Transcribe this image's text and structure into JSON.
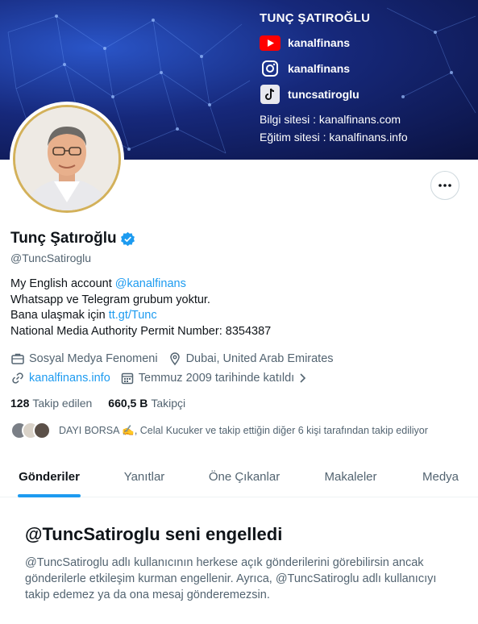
{
  "banner": {
    "name": "TUNÇ ŞATIROĞLU",
    "socials": [
      {
        "icon": "youtube-icon",
        "label": "kanalfinans"
      },
      {
        "icon": "instagram-icon",
        "label": "kanalfinans"
      },
      {
        "icon": "tiktok-icon",
        "label": "tuncsatiroglu"
      }
    ],
    "info_site": "Bilgi sitesi : kanalfinans.com",
    "edu_site": "Eğitim sitesi : kanalfinans.info"
  },
  "profile": {
    "display_name": "Tunç Şatıroğlu",
    "handle": "@TuncSatiroglu",
    "bio": {
      "line1_text": "My English account ",
      "line1_link": "@kanalfinans",
      "line2": "Whatsapp ve Telegram grubum yoktur.",
      "line3_text": "Bana ulaşmak için ",
      "line3_link": "tt.gt/Tunc",
      "line4": "National Media Authority Permit Number: 8354387"
    },
    "category": "Sosyal Medya Fenomeni",
    "location": "Dubai, United Arab Emirates",
    "website": "kanalfinans.info",
    "joined": "Temmuz 2009 tarihinde katıldı",
    "following_count": "128",
    "following_label": "Takip edilen",
    "followers_count": "660,5 B",
    "followers_label": "Takipçi",
    "followed_by": "DAYI BORSA ✍️, Celal Kucuker ve takip ettiğin diğer 6 kişi tarafından takip ediliyor"
  },
  "tabs": [
    {
      "label": "Gönderiler",
      "active": true
    },
    {
      "label": "Yanıtlar",
      "active": false
    },
    {
      "label": "Öne Çıkanlar",
      "active": false
    },
    {
      "label": "Makaleler",
      "active": false
    },
    {
      "label": "Medya",
      "active": false
    }
  ],
  "blocked": {
    "title": "@TuncSatiroglu seni engelledi",
    "text": "@TuncSatiroglu adlı kullanıcının herkese açık gönderilerini görebilirsin ancak gönderilerle etkileşim kurman engellenir. Ayrıca, @TuncSatiroglu adlı kullanıcıyı takip edemez ya da ona mesaj gönderemezsin."
  },
  "colors": {
    "accent": "#1d9bf0",
    "text_primary": "#0f1419",
    "text_secondary": "#536471"
  }
}
